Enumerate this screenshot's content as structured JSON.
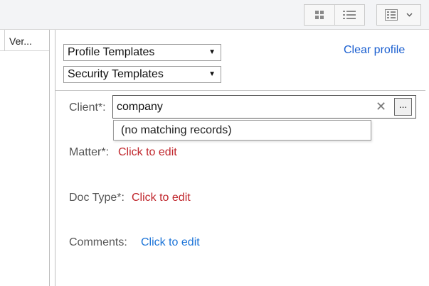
{
  "toolbar": {
    "icons": [
      "grid-view-icon",
      "list-view-icon",
      "details-layout-icon",
      "chevron-down-icon"
    ]
  },
  "left_pane": {
    "column_header": "Ver..."
  },
  "templates": {
    "profile": {
      "value": "Profile Templates"
    },
    "security": {
      "value": "Security Templates"
    },
    "clear_link": "Clear profile"
  },
  "fields": {
    "client": {
      "label": "Client*:",
      "value": "company",
      "clear_symbol": "✕",
      "browse_label": "...",
      "suggestion": "(no matching records)"
    },
    "matter": {
      "label": "Matter*:",
      "action": "Click to edit"
    },
    "doc_type": {
      "label": "Doc Type*:",
      "action": "Click to edit"
    },
    "comments": {
      "label": "Comments:",
      "action": "Click to edit"
    }
  },
  "colors": {
    "required_link": "#c0262c",
    "optional_link": "#1a73d8",
    "clear_link": "#1a5fd0"
  }
}
